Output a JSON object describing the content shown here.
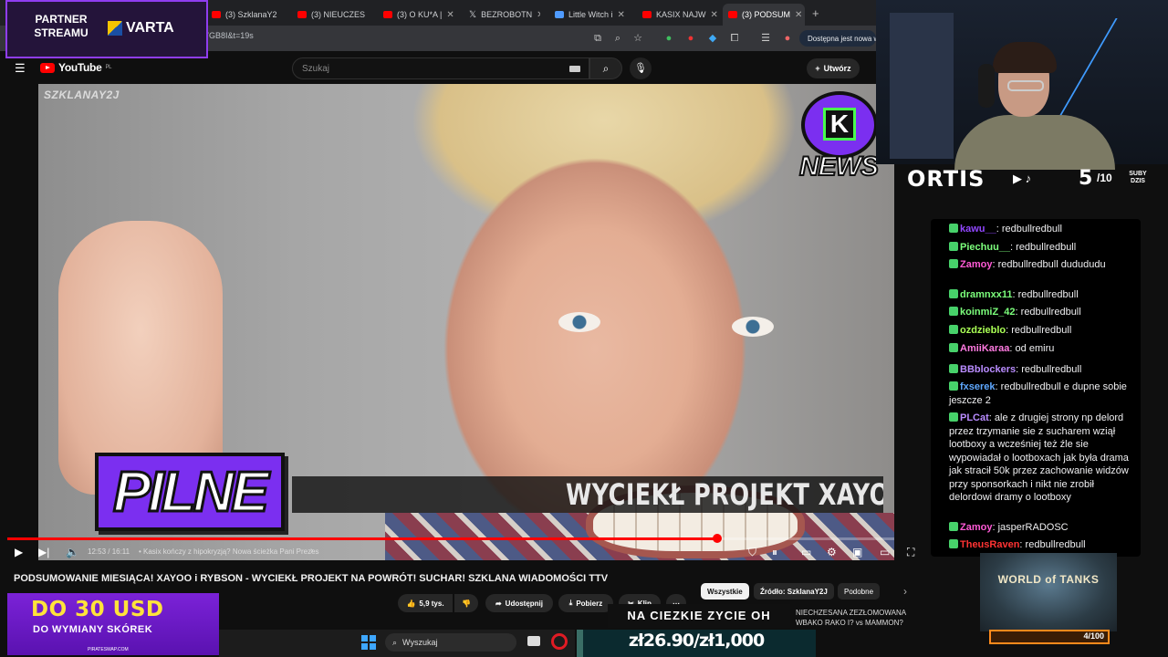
{
  "browser": {
    "tabs": [
      {
        "label": "(3) SzklanaY2"
      },
      {
        "label": "(3) NIEUCZES"
      },
      {
        "label": "(3) O KU*A |"
      },
      {
        "label": "BEZROBOTN"
      },
      {
        "label": "Little Witch i"
      },
      {
        "label": "KASIX NAJW"
      },
      {
        "label": "(3) PODSUM"
      }
    ],
    "url": "7GB8I&t=19s",
    "update_notice": "Dostępna jest nowa w"
  },
  "youtube": {
    "logo": "YouTube",
    "logo_region": "PL",
    "search_placeholder": "Szukaj",
    "create_label": "Utwórz",
    "video_title": "PODSUMOWANIE MIESIĄCA! XAYOO i RYBSON - WYCIEKŁ PROJEKT NA POWRÓT! SUCHAR! SZKLANA WIADOMOŚCI TTV",
    "time": "12:53 / 16:11",
    "chapter": "• Kasix kończy z hipokryzją? Nowa ścieżka Pani Prezes",
    "progress": 0.8,
    "likes": "5,9 tys.",
    "share": "Udostępnij",
    "download": "Pobierz",
    "clip": "Klip",
    "chips": [
      "Wszystkie",
      "Źródło: SzklanaY2J",
      "Podobne"
    ]
  },
  "video_overlay": {
    "watermark": "SZKLANAY2J",
    "news_badge": "NEWS",
    "pilne": "PILNE",
    "ticker": "WYCIEKŁ PROJEKT XAYOO N"
  },
  "stream": {
    "partner": "PARTNER STREAMU",
    "sponsor": "VARTA",
    "streamer": "ORTIS",
    "subs_today": "5",
    "subs_goal": "/10",
    "subs_label": "SUBY DZIS",
    "ad_main": "DO 30 USD",
    "ad_sub": "DO WYMIANY SKÓREK",
    "ad_foot": "PIRATESWAP.COM",
    "goal_title": "NA CIEZKIE ZYCIE OH",
    "goal_amount": "zł26.90/zł1,000",
    "goal_progress": 0.0269,
    "news_scroll_1": "NIECHZESANA ZEZŁOMOWANA",
    "news_scroll_2": "WBAKO   RAKO I? vs MAMMON?",
    "wot_title": "WORLD of TANKS",
    "wot_count": "4/100",
    "wot_progress": 0.04
  },
  "taskbar": {
    "search": "Wyszukaj"
  },
  "chat": [
    {
      "user": "kawu__",
      "text": "redbullredbull",
      "color": "#9147ff"
    },
    {
      "user": "Piechuu__",
      "text": "redbullredbull",
      "color": "#7cff7c"
    },
    {
      "user": "Zamoy",
      "text": "redbullredbull dudududu",
      "color": "#ff5ad6"
    },
    {
      "user": "dramnxx11",
      "text": "redbullredbull",
      "color": "#7cff7c"
    },
    {
      "user": "koinmiZ_42",
      "text": "redbullredbull",
      "color": "#7cff7c"
    },
    {
      "user": "ozdzieblo",
      "text": "redbullredbull",
      "color": "#aaff55"
    },
    {
      "user": "AmiiKaraa",
      "text": "od emiru",
      "color": "#ff7ae0"
    },
    {
      "user": "BBblockers",
      "text": "redbullredbull",
      "color": "#b98cff"
    },
    {
      "user": "fxserek",
      "text": "redbullredbull e dupne sobie jeszcze 2",
      "color": "#5fa8ff"
    },
    {
      "user": "PLCat",
      "text": "ale z drugiej strony np delord przez trzymanie sie z sucharem wziął lootboxy a wcześniej też źle sie wypowiadał o lootboxach jak była drama jak stracił 50k przez zachowanie widzów przy sponsorkach i nikt nie zrobił delordowi dramy o lootboxy",
      "color": "#b98cff"
    },
    {
      "user": "Zamoy",
      "text": "jasperRADOSC",
      "color": "#ff5ad6"
    },
    {
      "user": "TheusRaven",
      "text": "redbullredbull",
      "color": "#ff3333"
    }
  ],
  "colors": {
    "accent_purple": "#7b2ff0",
    "yt_red": "#ff0000",
    "news_green": "#48ff4c"
  }
}
